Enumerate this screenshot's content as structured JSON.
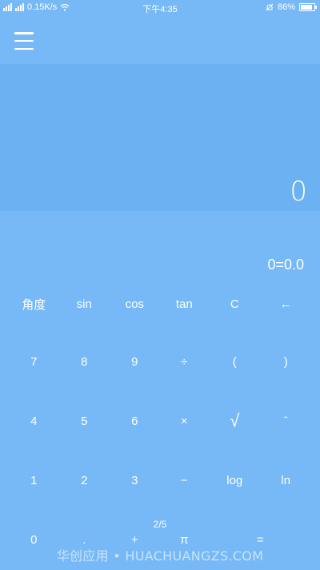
{
  "status_bar": {
    "carrier_1": "3G",
    "carrier_2": "4G",
    "net_speed": "0.15K/s",
    "time": "下午4:35",
    "battery_percent": "86%",
    "battery_level": 0.86,
    "icons": [
      "signal-icon",
      "wifi-icon",
      "alarm-off-icon",
      "battery-icon"
    ]
  },
  "header": {
    "menu_icon": "hamburger-menu-icon"
  },
  "display": {
    "value": "0"
  },
  "result": {
    "text": "0=0.0"
  },
  "keys": {
    "row1": [
      "角度",
      "sin",
      "cos",
      "tan",
      "C",
      "←"
    ],
    "row2": [
      "7",
      "8",
      "9",
      "÷",
      "(",
      ")"
    ],
    "row3": [
      "4",
      "5",
      "6",
      "×",
      "√",
      "ˆ"
    ],
    "row4": [
      "1",
      "2",
      "3",
      "−",
      "log",
      "ln"
    ],
    "row5": [
      "0",
      ".",
      "+",
      "π",
      "",
      "="
    ]
  },
  "page_indicator": "2/5",
  "watermark": "华创应用 • HUACHUANGZS.COM",
  "colors": {
    "background": "#76b9f6",
    "display_panel": "#6cb2f2",
    "text": "#ffffff"
  }
}
